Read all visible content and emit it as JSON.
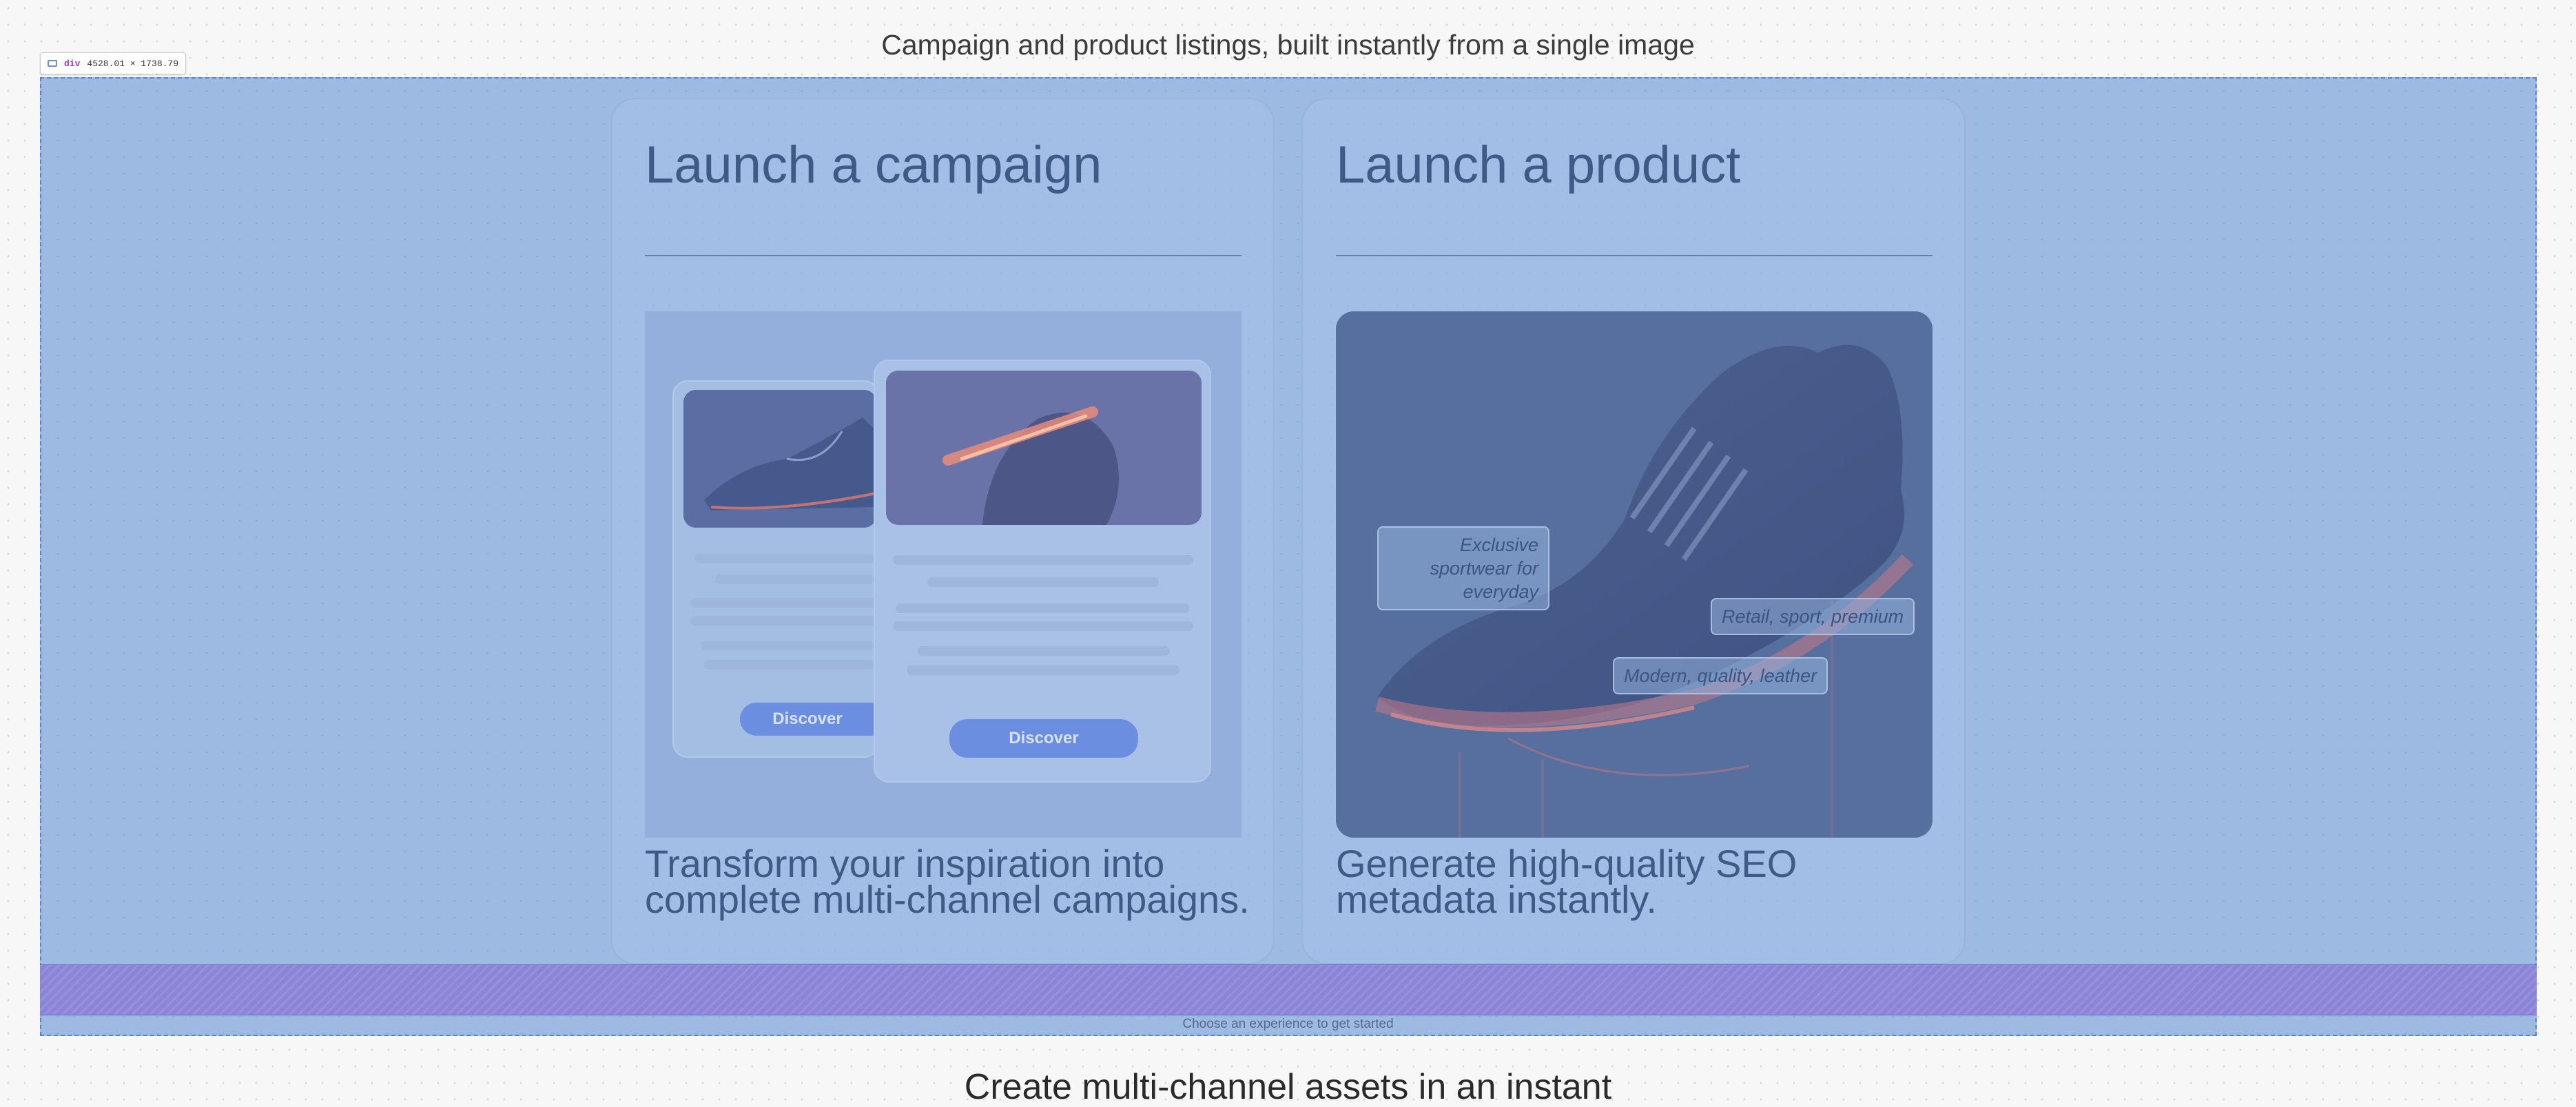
{
  "page": {
    "title": "Campaign and product listings, built instantly from a single image",
    "footer_hint": "Choose an experience to get started",
    "next_section_title": "Create multi-channel assets in an instant"
  },
  "inspector": {
    "element": "div",
    "size": "4528.01 × 1738.79"
  },
  "cards": [
    {
      "title": "Launch a campaign",
      "description": "Transform your inspiration into complete multi-channel campaigns.",
      "mock_button_back": "Discover",
      "mock_button_front": "Discover"
    },
    {
      "title": "Launch a product",
      "description": "Generate high-quality SEO metadata instantly.",
      "tags": [
        "Exclusive sportwear for everyday",
        "Retail, sport, premium",
        "Modern, quality, leather"
      ]
    }
  ],
  "colors": {
    "overlay": "#76a0da",
    "padding_band": "#8b85d8",
    "button": "#6b8ee0",
    "text_muted": "#3e5a86"
  }
}
